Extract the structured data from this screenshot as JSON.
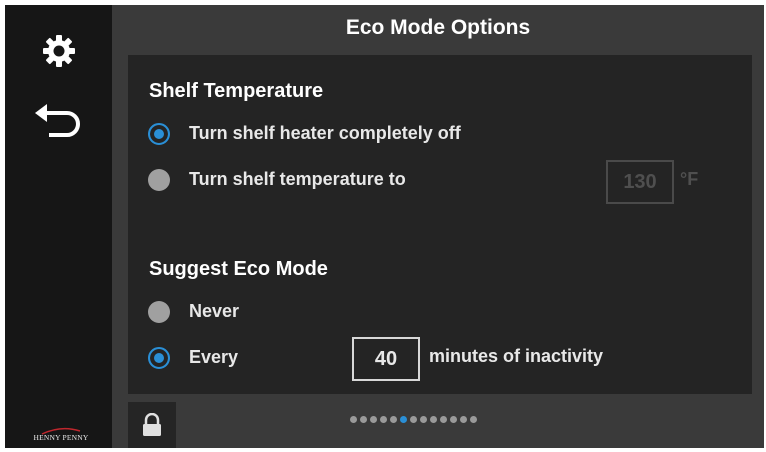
{
  "sidebar": {
    "settings_icon": "gear-icon",
    "back_icon": "back-arrow-icon",
    "logo_text": "HENNY PENNY"
  },
  "header": {
    "title": "Eco Mode Options"
  },
  "shelf_temperature": {
    "heading": "Shelf Temperature",
    "options": [
      {
        "label": "Turn shelf heater completely off",
        "selected": true
      },
      {
        "label": "Turn shelf temperature to",
        "selected": false
      }
    ],
    "temperature_value": "130",
    "temperature_unit": "°F"
  },
  "suggest_eco_mode": {
    "heading": "Suggest Eco Mode",
    "options": [
      {
        "label": "Never",
        "selected": false
      },
      {
        "label": "Every",
        "selected": true
      }
    ],
    "minutes_value": "40",
    "minutes_label": "minutes of inactivity"
  },
  "footer": {
    "lock_icon": "lock-icon",
    "page_count": 13,
    "active_page": 5
  },
  "colors": {
    "accent": "#2a8fd6",
    "background": "#3a3a3a",
    "panel": "#242424",
    "sidebar": "#161616"
  }
}
